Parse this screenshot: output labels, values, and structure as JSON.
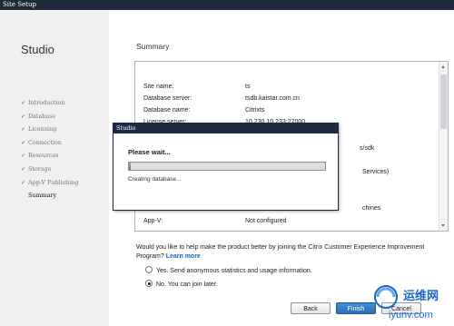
{
  "window": {
    "title": "Site Setup"
  },
  "app": {
    "title": "Studio"
  },
  "nav": {
    "items": [
      {
        "label": "Introduction",
        "done": true
      },
      {
        "label": "Database",
        "done": true
      },
      {
        "label": "Licensing",
        "done": true
      },
      {
        "label": "Connection",
        "done": true
      },
      {
        "label": "Resources",
        "done": true
      },
      {
        "label": "Storage",
        "done": true
      },
      {
        "label": "App-V Publishing",
        "done": true
      },
      {
        "label": "Summary",
        "done": false,
        "active": true
      }
    ],
    "check_glyph": "✔"
  },
  "summary": {
    "title": "Summary",
    "rows": [
      {
        "key": "Site name:",
        "value": "ts"
      },
      {
        "key": "Database server:",
        "value": "tsdb.kaistar.com.cn"
      },
      {
        "key": "Database name:",
        "value": "Citrixts"
      },
      {
        "key": "License server:",
        "value": "10.230.10.233:27000"
      }
    ],
    "partial_fragments": [
      "s/sdk",
      "Services)",
      "chines"
    ],
    "last_row": {
      "key": "App-V:",
      "value": "Not configured"
    }
  },
  "ceip": {
    "prompt": "Would you like to help make the product better by joining the Citrix Customer Experience Improvement Program?",
    "learn_more": "Learn more",
    "options": [
      {
        "label": "Yes. Send anonymous statistics and usage information.",
        "selected": false
      },
      {
        "label": "No. You can join later.",
        "selected": true
      }
    ]
  },
  "buttons": {
    "back": "Back",
    "finish": "Finish",
    "cancel": "Cancel"
  },
  "dialog": {
    "title": "Studio",
    "heading": "Please wait...",
    "status": "Creating database...",
    "progress": 0.01
  },
  "watermark": {
    "cn": "运维网",
    "url": "iyunv.com"
  },
  "colors": {
    "accent": "#2c6fb4",
    "titlebar": "#1d2a3a",
    "link": "#1a63b8"
  }
}
